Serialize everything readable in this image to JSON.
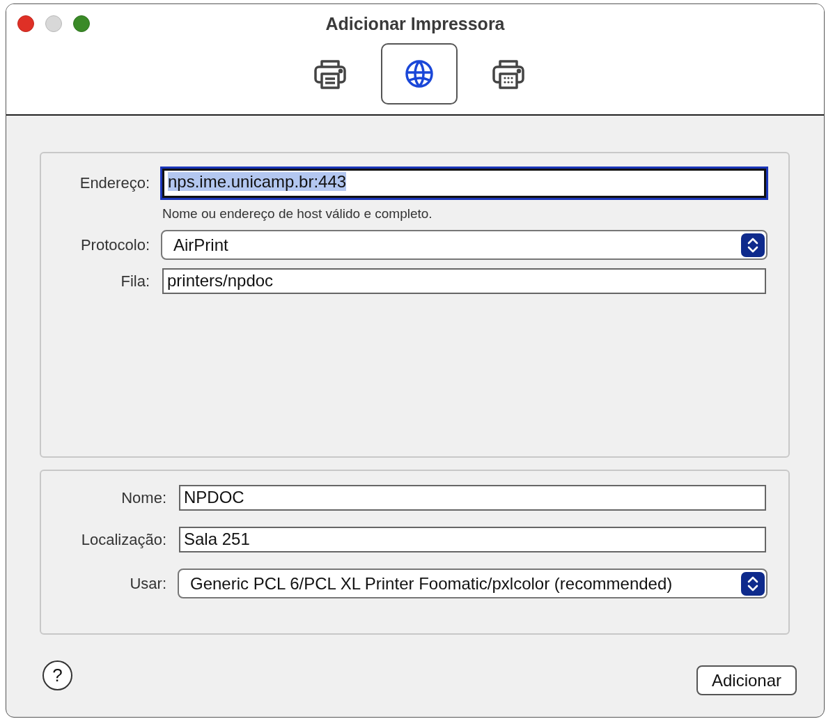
{
  "window": {
    "title": "Adicionar Impressora",
    "controls": [
      {
        "kind": "close"
      },
      {
        "kind": "minimize"
      },
      {
        "kind": "zoom"
      }
    ]
  },
  "toolbar": {
    "tabs": [
      {
        "kind": "printer",
        "selected": false
      },
      {
        "kind": "globe",
        "selected": true
      },
      {
        "kind": "printer-grid",
        "selected": false
      }
    ]
  },
  "connection": {
    "fields": [
      {
        "kind": "text",
        "label": "Endereço:",
        "value": "nps.ime.unicamp.br:443",
        "focused": true,
        "hint": "Nome ou endereço de host válido e completo."
      },
      {
        "kind": "popup",
        "label": "Protocolo:",
        "value": "AirPrint"
      },
      {
        "kind": "text",
        "label": "Fila:",
        "value": "printers/npdoc",
        "focused": false
      }
    ]
  },
  "details": {
    "fields": [
      {
        "kind": "text",
        "label": "Nome:",
        "value": "NPDOC",
        "focused": false
      },
      {
        "kind": "text",
        "label": "Localização:",
        "value": "Sala 251",
        "focused": false
      },
      {
        "kind": "popup",
        "label": "Usar:",
        "value": "Generic PCL 6/PCL XL Printer Foomatic/pxlcolor (recommended)"
      }
    ]
  },
  "help_button": {
    "label": "?"
  },
  "buttons": [
    {
      "label": "Adicionar"
    }
  ]
}
